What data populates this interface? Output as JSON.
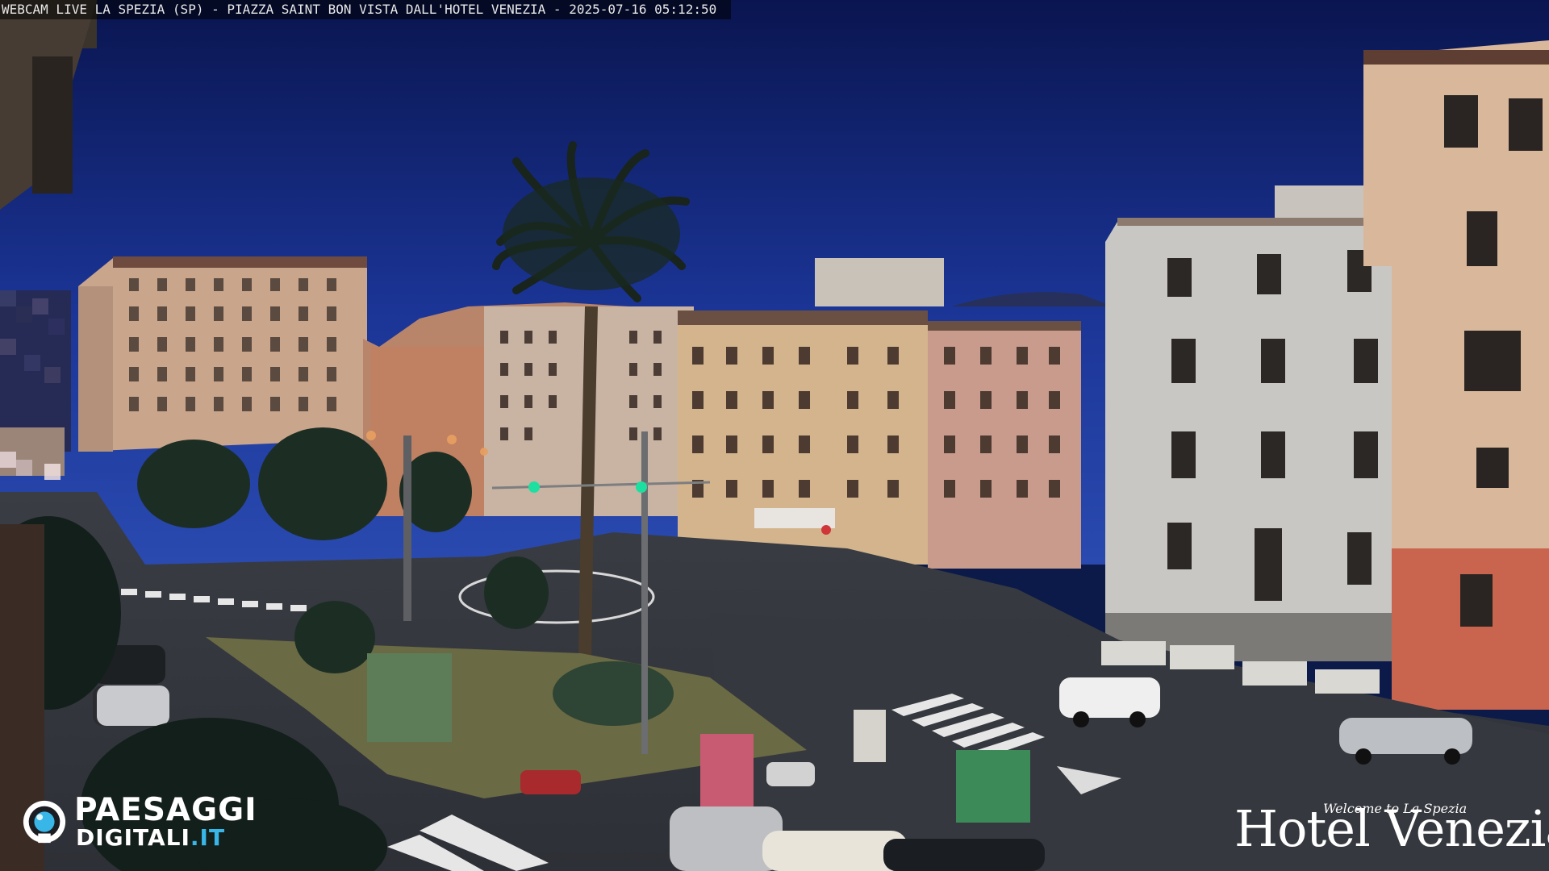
{
  "overlay": {
    "caption": "WEBCAM LIVE LA SPEZIA (SP) - PIAZZA SAINT BON VISTA DALL'HOTEL VENEZIA - 2025-07-16 05:12:50"
  },
  "logos": {
    "left": {
      "line1": "PAESAGGI",
      "line2_main": "DIGITALI",
      "line2_accent": ".IT"
    },
    "right": {
      "tagline": "Welcome to La Spezia",
      "name": "Hotel Venezia"
    }
  },
  "colors": {
    "sky": "#0c1a4a",
    "accent": "#38b6e8",
    "traffic_light": "#1de0a0"
  }
}
